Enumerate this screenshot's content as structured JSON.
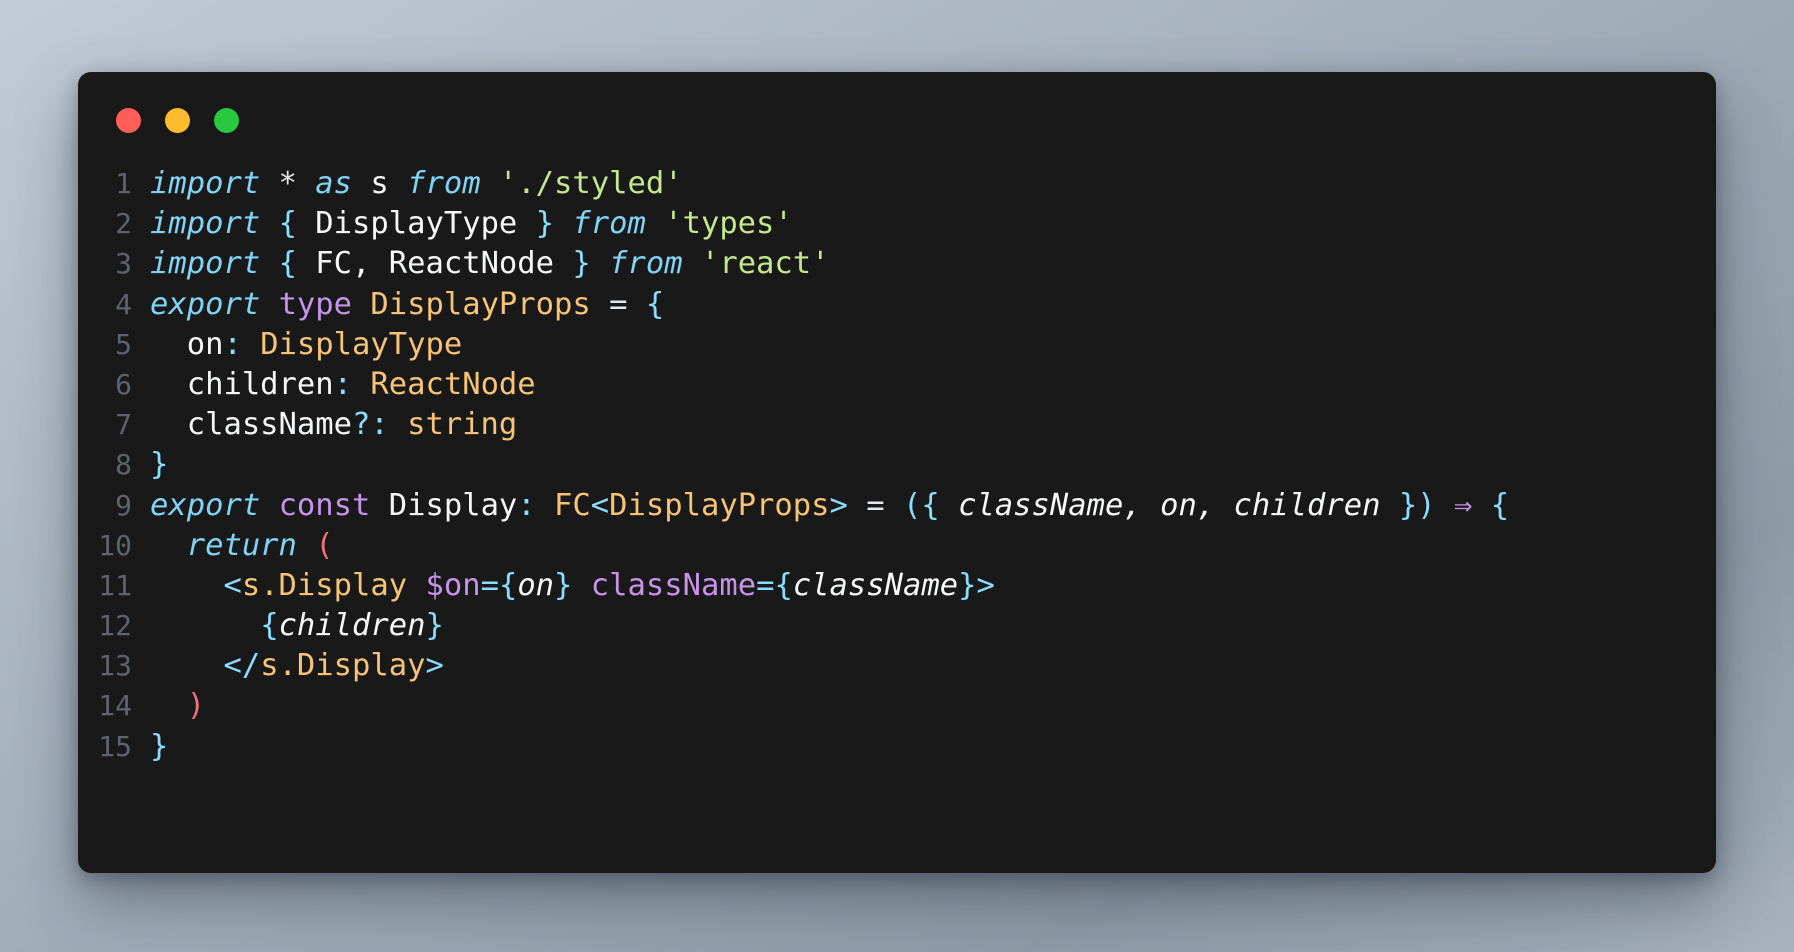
{
  "window": {
    "title": "",
    "traffic_lights": [
      {
        "name": "close",
        "color": "#ff5f57"
      },
      {
        "name": "minimize",
        "color": "#febc2e"
      },
      {
        "name": "maximize",
        "color": "#28c840"
      }
    ]
  },
  "editor": {
    "language": "tsx",
    "background": "#191919",
    "line_number_color": "#5c6370",
    "lines": [
      {
        "n": "1",
        "text": "import * as s from './styled'"
      },
      {
        "n": "2",
        "text": "import { DisplayType } from 'types'"
      },
      {
        "n": "3",
        "text": "import { FC, ReactNode } from 'react'"
      },
      {
        "n": "4",
        "text": "export type DisplayProps = {"
      },
      {
        "n": "5",
        "text": "  on: DisplayType"
      },
      {
        "n": "6",
        "text": "  children: ReactNode"
      },
      {
        "n": "7",
        "text": "  className?: string"
      },
      {
        "n": "8",
        "text": "}"
      },
      {
        "n": "9",
        "text": "export const Display: FC<DisplayProps> = ({ className, on, children }) => {"
      },
      {
        "n": "10",
        "text": "  return ("
      },
      {
        "n": "11",
        "text": "    <s.Display $on={on} className={className}>"
      },
      {
        "n": "12",
        "text": "      {children}"
      },
      {
        "n": "13",
        "text": "    </s.Display>"
      },
      {
        "n": "14",
        "text": "  )"
      },
      {
        "n": "15",
        "text": "}"
      }
    ],
    "tokens": {
      "keyword": "#7fd4f5",
      "keyword_alt": "#c792ea",
      "string": "#c3e88d",
      "type": "#f7c377",
      "punctuation": "#89ddff",
      "operator": "#e4e7eb",
      "identifier": "#f5f6f7",
      "paren_return": "#f07178",
      "arrow_glyph": "⇒"
    }
  }
}
